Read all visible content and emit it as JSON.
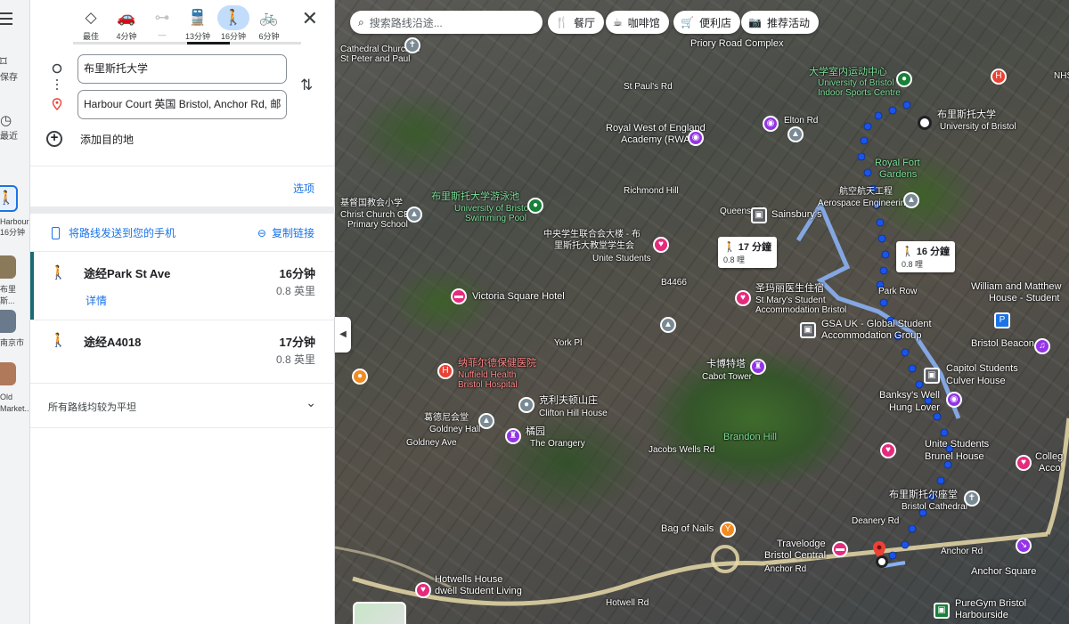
{
  "rail": {
    "saved_label": "保存",
    "recent_label": "最近",
    "items": [
      {
        "label": "Harbour...\n16分钟",
        "line1": "Harbour...",
        "line2": "16分钟"
      },
      {
        "label": "布里斯...",
        "line1": "布里斯..."
      },
      {
        "label": "南京市",
        "line1": "南京市"
      },
      {
        "label": "Old Market...",
        "line1": "Old",
        "line2": "Market..."
      }
    ]
  },
  "modes": [
    {
      "name": "best",
      "label": "最佳",
      "icon": "◇"
    },
    {
      "name": "drive",
      "label": "4分钟",
      "icon": "🚗"
    },
    {
      "name": "bike-disabled",
      "label": "—",
      "icon": "⊶"
    },
    {
      "name": "transit",
      "label": "13分钟",
      "icon": "🚆"
    },
    {
      "name": "walk",
      "label": "16分钟",
      "icon": "🚶"
    },
    {
      "name": "bicycle",
      "label": "6分钟",
      "icon": "🚲"
    }
  ],
  "waypoints": {
    "origin": "布里斯托大学",
    "destination": "Harbour Court 英国 Bristol, Anchor Rd, 邮"
  },
  "add_destination": "添加目的地",
  "options": "选项",
  "send_to_phone": "将路线发送到您的手机",
  "copy_link": "复制链接",
  "routes": [
    {
      "via": "途经Park St Ave",
      "time": "16分钟",
      "distance": "0.8 英里",
      "details": "详情"
    },
    {
      "via": "途经A4018",
      "time": "17分钟",
      "distance": "0.8 英里"
    }
  ],
  "flat_note": "所有路线均较为平坦",
  "map": {
    "search_placeholder": "搜索路线沿途...",
    "chips": [
      "餐厅",
      "咖啡馆",
      "便利店",
      "推荐活动"
    ],
    "walk_labels": [
      {
        "time": "17 分鐘",
        "dist": "0.8 哩"
      },
      {
        "time": "16 分鐘",
        "dist": "0.8 哩"
      }
    ],
    "labels": [
      {
        "text": "Cathedral Church of",
        "cls": ""
      },
      {
        "text": "St Peter and Paul",
        "cls": ""
      },
      {
        "text": "Priory Road Complex",
        "cls": ""
      },
      {
        "text": "大学室内运动中心",
        "cls": "green"
      },
      {
        "text": "University of Bristol",
        "cls": "green"
      },
      {
        "text": "Indoor Sports Centre",
        "cls": "green"
      },
      {
        "text": "NHS",
        "cls": ""
      },
      {
        "text": "布里斯托大学",
        "cls": "big"
      },
      {
        "text": "University of Bristol",
        "cls": ""
      },
      {
        "text": "Royal West of England",
        "cls": ""
      },
      {
        "text": "Academy (RWA)",
        "cls": ""
      },
      {
        "text": "Royal Fort",
        "cls": "green"
      },
      {
        "text": "Gardens",
        "cls": "green"
      },
      {
        "text": "航空航天工程",
        "cls": ""
      },
      {
        "text": "Aerospace Engineering",
        "cls": ""
      },
      {
        "text": "布里斯托大学游泳池",
        "cls": "green"
      },
      {
        "text": "University of Bristol",
        "cls": "green"
      },
      {
        "text": "Swimming Pool",
        "cls": "green"
      },
      {
        "text": "Richmond Hill",
        "cls": ""
      },
      {
        "text": "Sainsbury's",
        "cls": ""
      },
      {
        "text": "基督国教会小学",
        "cls": ""
      },
      {
        "text": "Christ Church CE",
        "cls": ""
      },
      {
        "text": "Primary School",
        "cls": ""
      },
      {
        "text": "中央学生联合会大楼 - 布",
        "cls": ""
      },
      {
        "text": "里斯托大教堂学生会",
        "cls": ""
      },
      {
        "text": "Unite Students",
        "cls": ""
      },
      {
        "text": "William and Matthew",
        "cls": ""
      },
      {
        "text": "House - Student",
        "cls": ""
      },
      {
        "text": "Victoria Square Hotel",
        "cls": "big"
      },
      {
        "text": "圣玛丽医生住宿",
        "cls": "big"
      },
      {
        "text": "St Mary's Student",
        "cls": ""
      },
      {
        "text": "Accommodation Bristol",
        "cls": ""
      },
      {
        "text": "GSA UK - Global Student",
        "cls": "big"
      },
      {
        "text": "Accommodation Group",
        "cls": "big"
      },
      {
        "text": "Bristol Beacon",
        "cls": "big"
      },
      {
        "text": "纳菲尔德保健医院",
        "cls": "red"
      },
      {
        "text": "Nuffield Health",
        "cls": "red"
      },
      {
        "text": "Bristol Hospital",
        "cls": "red"
      },
      {
        "text": "卡博特塔",
        "cls": "big"
      },
      {
        "text": "Cabot Tower",
        "cls": ""
      },
      {
        "text": "Capitol Students",
        "cls": "big"
      },
      {
        "text": "Culver House",
        "cls": "big"
      },
      {
        "text": "Banksy's Well",
        "cls": "big"
      },
      {
        "text": "Hung Lover",
        "cls": "big"
      },
      {
        "text": "克利夫顿山庄",
        "cls": "big"
      },
      {
        "text": "Clifton Hill House",
        "cls": ""
      },
      {
        "text": "Brandon Hill",
        "cls": "green"
      },
      {
        "text": "葛德尼会堂",
        "cls": ""
      },
      {
        "text": "Goldney Hall",
        "cls": ""
      },
      {
        "text": "橘园",
        "cls": "big"
      },
      {
        "text": "The Orangery",
        "cls": ""
      },
      {
        "text": "Unite Students",
        "cls": "big"
      },
      {
        "text": "Brunel House",
        "cls": "big"
      },
      {
        "text": "Colleg",
        "cls": "big"
      },
      {
        "text": "Acco",
        "cls": "big"
      },
      {
        "text": "布里斯托尔座堂",
        "cls": "big"
      },
      {
        "text": "Bristol Cathedral",
        "cls": ""
      },
      {
        "text": "Bag of Nails",
        "cls": "big"
      },
      {
        "text": "Travelodge",
        "cls": "big"
      },
      {
        "text": "Bristol Central",
        "cls": "big"
      },
      {
        "text": "Anchor Square",
        "cls": "big"
      },
      {
        "text": "Hotwells House",
        "cls": "big"
      },
      {
        "text": "dwell Student Living",
        "cls": "big"
      },
      {
        "text": "PureGym Bristol",
        "cls": "big"
      },
      {
        "text": "Harbourside",
        "cls": "big"
      },
      {
        "text": "Anchor Rd",
        "cls": ""
      },
      {
        "text": "Anchor Rd",
        "cls": ""
      },
      {
        "text": "Hotwell Rd",
        "cls": ""
      },
      {
        "text": "Park Row",
        "cls": ""
      },
      {
        "text": "Queens Rd",
        "cls": ""
      },
      {
        "text": "St Paul's Rd",
        "cls": ""
      },
      {
        "text": "Elton Rd",
        "cls": ""
      },
      {
        "text": "B4466",
        "cls": ""
      },
      {
        "text": "Jacobs Wells Rd",
        "cls": ""
      },
      {
        "text": "Goldney Ave",
        "cls": ""
      },
      {
        "text": "Deanery Rd",
        "cls": ""
      },
      {
        "text": "York Pl",
        "cls": ""
      }
    ]
  },
  "colors": {
    "accent": "#1a73e8",
    "route_main": "#1a55e8",
    "route_alt": "#8ab0f2",
    "selected_route_bar": "#1a6b73"
  }
}
